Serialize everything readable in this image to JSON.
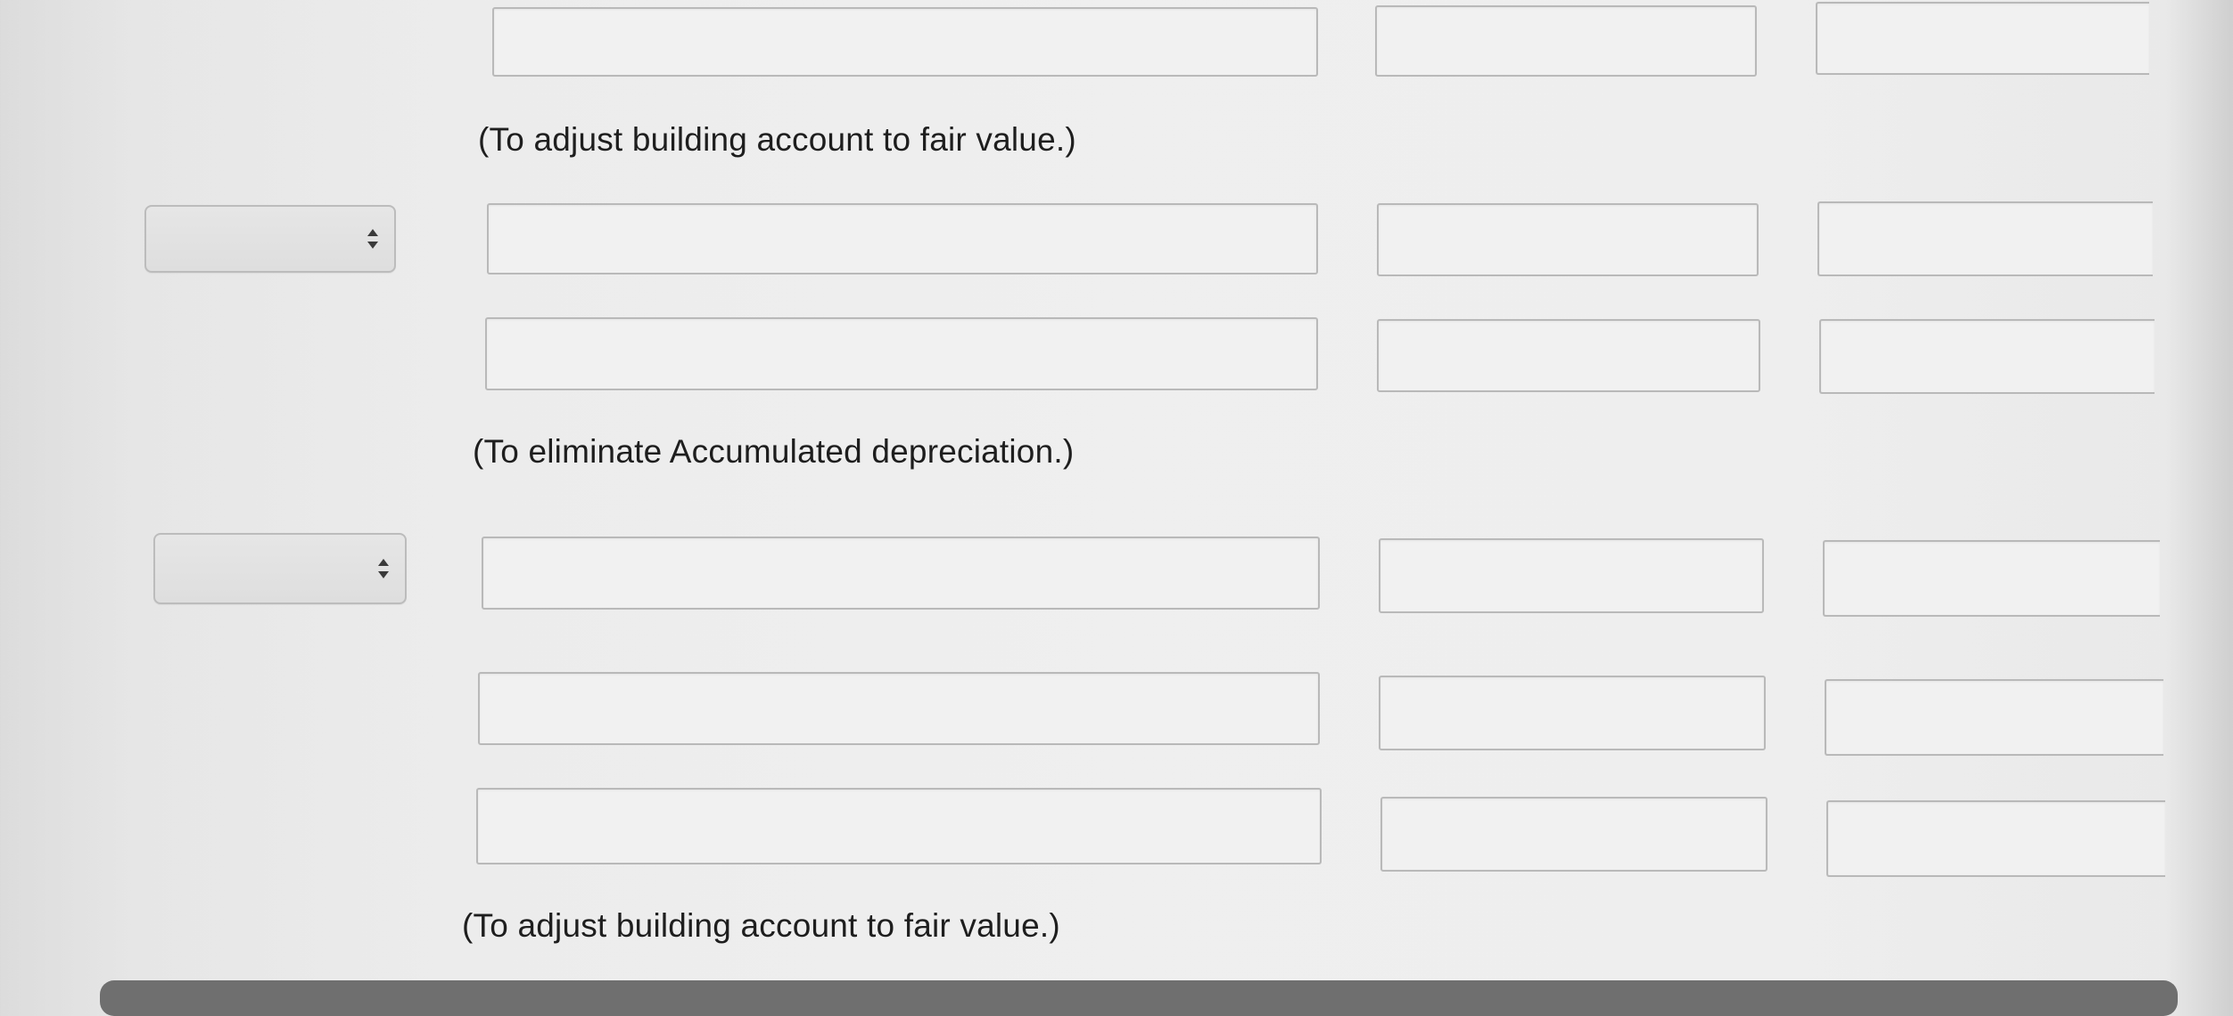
{
  "entries": [
    {
      "account_select": null,
      "rows": [
        {
          "account": "",
          "debit": "",
          "credit": ""
        }
      ],
      "note": "(To adjust building account to fair value.)"
    },
    {
      "account_select": {
        "selected": ""
      },
      "rows": [
        {
          "account": "",
          "debit": "",
          "credit": ""
        },
        {
          "account": "",
          "debit": "",
          "credit": ""
        }
      ],
      "note": "(To eliminate Accumulated depreciation.)"
    },
    {
      "account_select": {
        "selected": ""
      },
      "rows": [
        {
          "account": "",
          "debit": "",
          "credit": ""
        },
        {
          "account": "",
          "debit": "",
          "credit": ""
        },
        {
          "account": "",
          "debit": "",
          "credit": ""
        }
      ],
      "note": "(To adjust building account to fair value.)"
    }
  ],
  "icons": {
    "select_arrow": "up-down-chevron-icon"
  },
  "colors": {
    "background": "#efefef",
    "field_border": "#b9b9b9",
    "text": "#1e1e1e",
    "scrollbar": "#6f6f6f"
  }
}
